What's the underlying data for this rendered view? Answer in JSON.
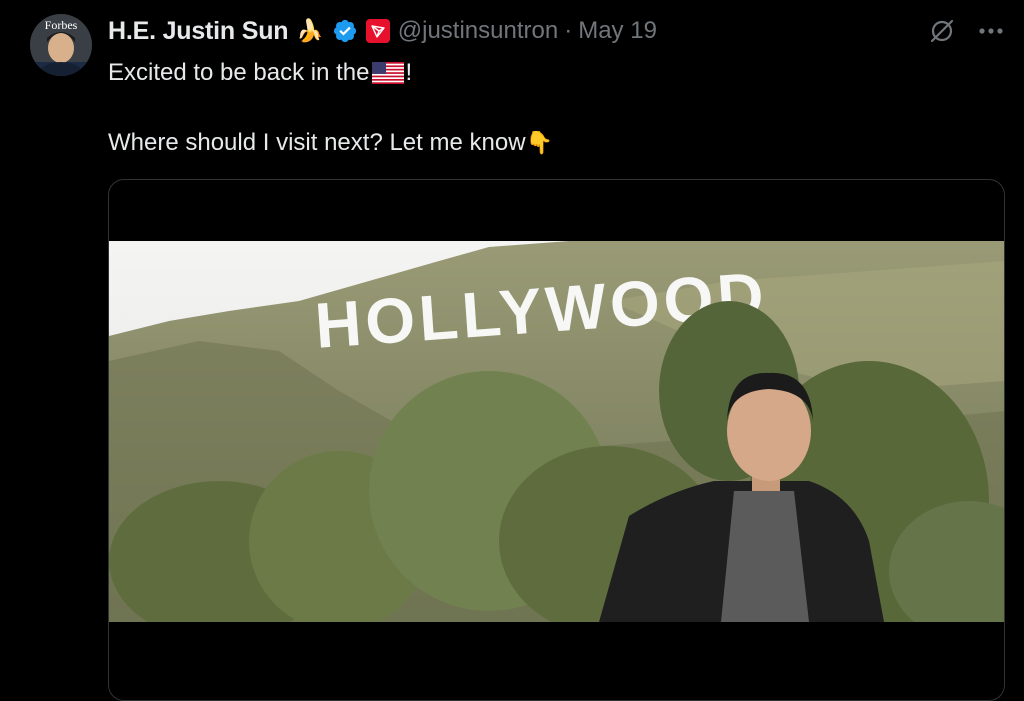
{
  "tweet": {
    "avatar_text": "Forbes",
    "author_name": "H.E. Justin Sun",
    "name_emoji": "🍌",
    "handle": "@justinsuntron",
    "separator": "·",
    "date": "May 19",
    "text_line1_before_flag": "Excited to be back in the",
    "text_line1_after_flag": "!",
    "text_line2": "Where should I visit next? Let me know",
    "text_line2_emoji": "👇",
    "media": {
      "sign_text": "HOLLYWOOD"
    }
  },
  "icons": {
    "verified": "verified-check-icon",
    "affiliate": "tron-logo-icon",
    "grok": "grok-icon",
    "more": "more-dots-icon",
    "flag": "us-flag-icon"
  },
  "colors": {
    "background": "#000000",
    "text": "#e7e9ea",
    "muted": "#71767b",
    "verified": "#1d9bf0",
    "tron": "#e8112d",
    "border": "#2f3336"
  }
}
